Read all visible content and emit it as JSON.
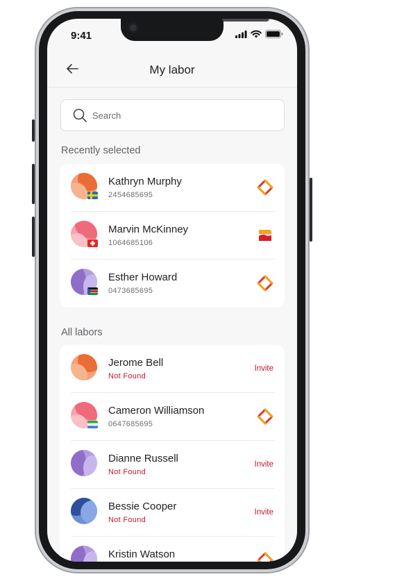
{
  "status_bar": {
    "time": "9:41"
  },
  "header": {
    "title": "My labor"
  },
  "search": {
    "placeholder": "Search"
  },
  "recent": {
    "title": "Recently selected",
    "items": [
      {
        "name": "Kathryn Murphy",
        "sub": "2454685695",
        "avatar_color": "#f08a4b",
        "flag": "sweden",
        "right": "ring-logo-icon"
      },
      {
        "name": "Marvin McKinney",
        "sub": "1064685106",
        "avatar_color": "#ef6b7b",
        "flag": "switzerland",
        "right": "card-logo-icon"
      },
      {
        "name": "Esther Howard",
        "sub": "0473685695",
        "avatar_color": "#8f6ec9",
        "flag": "south-sudan",
        "right": "ring-logo-icon"
      }
    ]
  },
  "all": {
    "title": "All labors",
    "items": [
      {
        "name": "Jerome Bell",
        "sub": "Not Found",
        "status": "not-found",
        "action": "Invite",
        "avatar_color": "#f08a4b"
      },
      {
        "name": "Cameron Williamson",
        "sub": "0647685695",
        "status": "ok",
        "avatar_color": "#ef6b7b",
        "flag": "sierra-leone",
        "right": "ring-logo-icon"
      },
      {
        "name": "Dianne Russell",
        "sub": "Not Found",
        "status": "not-found",
        "action": "Invite",
        "avatar_color": "#8f6ec9"
      },
      {
        "name": "Bessie Cooper",
        "sub": "Not Found",
        "status": "not-found",
        "action": "Invite",
        "avatar_color": "#3f63b0"
      },
      {
        "name": "Kristin Watson",
        "sub": "",
        "status": "ok",
        "avatar_color": "#8f6ec9",
        "right": "ring-logo-icon"
      }
    ]
  },
  "colors": {
    "accent_red": "#c0182b",
    "background": "#f7f7f7"
  }
}
